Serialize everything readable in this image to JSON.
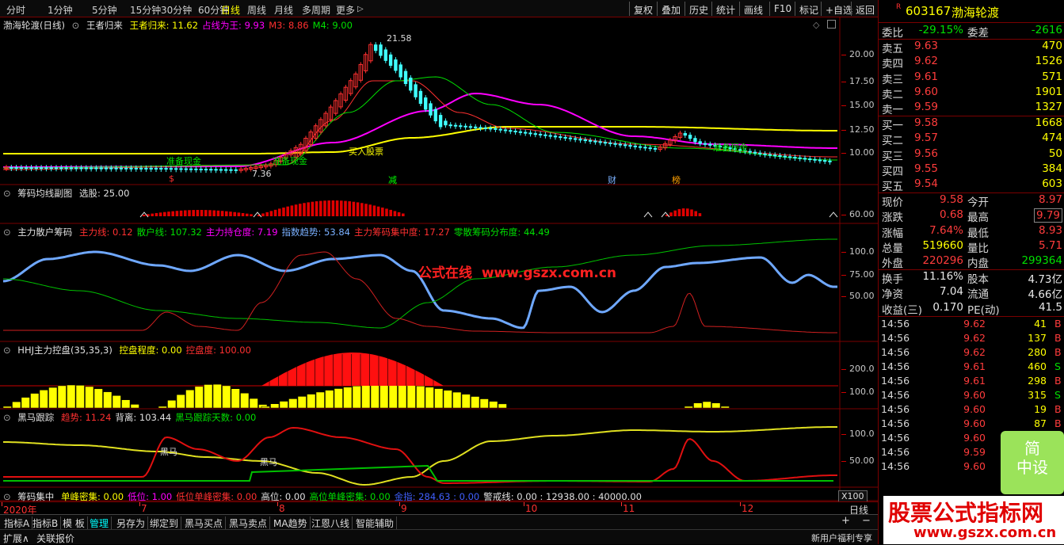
{
  "toolbar": {
    "periods": [
      "分时",
      "1分钟",
      "5分钟",
      "15分钟",
      "30分钟",
      "60分钟",
      "日线",
      "周线",
      "月线",
      "多周期",
      "更多"
    ],
    "active_period": "日线",
    "more_arrow": "▷",
    "right_buttons": [
      "复权",
      "叠加",
      "历史",
      "统计",
      "画线",
      "F10",
      "标记",
      "+自选",
      "返回"
    ]
  },
  "main_panel": {
    "title": "渤海轮渡(日线)",
    "indicator": "王者归来",
    "labels": [
      {
        "text": "王者归来: 11.62",
        "color": "#ffff00"
      },
      {
        "text": "占线为王: 9.93",
        "color": "#ff00ff"
      },
      {
        "text": "M3: 8.86",
        "color": "#ff3030"
      },
      {
        "text": "M4: 9.00",
        "color": "#00e000"
      }
    ],
    "y_ticks": [
      "20.00",
      "17.50",
      "15.00",
      "12.50",
      "10.00"
    ],
    "annotations": {
      "high_price": "21.58",
      "low_price": "7.36",
      "signal_1": "准备现金",
      "signal_2": "准备现金",
      "signal_3": "买入股票",
      "signal_4": "准备现金",
      "marker_s": "$",
      "marker_jian": "减",
      "marker_cai": "财",
      "marker_bang": "榜"
    }
  },
  "panel2": {
    "title": "筹码均线副图",
    "labels": [
      {
        "text": "选股: 25.00",
        "color": "#e0e0e0"
      }
    ],
    "y_ticks": [
      "60.00"
    ]
  },
  "panel3": {
    "title": "主力散户筹码",
    "labels": [
      {
        "text": "主力线: 0.12",
        "color": "#ff3030"
      },
      {
        "text": "散户线: 107.32",
        "color": "#00e000"
      },
      {
        "text": "主力持仓度: 7.19",
        "color": "#ff00ff"
      },
      {
        "text": "指数趋势: 53.84",
        "color": "#7ab0ff"
      },
      {
        "text": "主力筹码集中度: 17.27",
        "color": "#ff3030"
      },
      {
        "text": "零散筹码分布度: 44.49",
        "color": "#00e000"
      }
    ],
    "y_ticks": [
      "100.0",
      "75.00",
      "50.00"
    ],
    "watermark": "公式在线  www.gszx.com.cn"
  },
  "panel4": {
    "title": "HHJ主力控盘(35,35,3)",
    "labels": [
      {
        "text": "控盘程度: 0.00",
        "color": "#ffff00"
      },
      {
        "text": "控盘度: 100.00",
        "color": "#ff3030"
      }
    ],
    "y_ticks": [
      "200.0",
      "100.0"
    ]
  },
  "panel5": {
    "title": "黑马跟踪",
    "labels": [
      {
        "text": "趋势: 11.24",
        "color": "#ff3030"
      },
      {
        "text": "背离: 103.44",
        "color": "#e0e0e0"
      },
      {
        "text": "黑马跟踪天数: 0.00",
        "color": "#00e000"
      }
    ],
    "y_ticks": [
      "100.0",
      "50.00"
    ],
    "annotations": [
      "黑马",
      "黑马"
    ]
  },
  "panel6": {
    "title": "筹码集中",
    "labels": [
      {
        "text": "单峰密集: 0.00",
        "color": "#ffff00"
      },
      {
        "text": "低位: 1.00",
        "color": "#ff00ff"
      },
      {
        "text": "低位单峰密集: 0.00",
        "color": "#ff3030"
      },
      {
        "text": "高位: 0.00",
        "color": "#e0e0e0"
      },
      {
        "text": "高位单峰密集: 0.00",
        "color": "#00e000"
      },
      {
        "text": "金指: 284.63 : 0.00",
        "color": "#4060ff"
      },
      {
        "text": "警戒线: 0.00 : 12938.00 : 40000.00",
        "color": "#e0e0e0"
      }
    ],
    "zoom": "X100"
  },
  "date_axis": {
    "labels": [
      "2020年",
      "7",
      "8",
      "9",
      "10",
      "11",
      "12"
    ],
    "period_label": "日线"
  },
  "bottom_tabs": [
    "指标A",
    "指标B",
    "模 板",
    "管理",
    "另存为",
    "绑定到",
    "黑马买点",
    "黑马卖点",
    "MA趋势",
    "江恩八线",
    "智能辅助"
  ],
  "active_tab": "管理",
  "status": {
    "left1": "扩展∧",
    "left2": "关联报价",
    "right": "新用户福利专享"
  },
  "quote": {
    "r_mark": "R",
    "code": "603167",
    "name": "渤海轮渡",
    "wb_label": "委比",
    "wb_value": "-29.15%",
    "wc_label": "委差",
    "wc_value": "-2616",
    "asks": [
      {
        "label": "卖五",
        "price": "9.63",
        "vol": "470"
      },
      {
        "label": "卖四",
        "price": "9.62",
        "vol": "1526"
      },
      {
        "label": "卖三",
        "price": "9.61",
        "vol": "571"
      },
      {
        "label": "卖二",
        "price": "9.60",
        "vol": "1901"
      },
      {
        "label": "卖一",
        "price": "9.59",
        "vol": "1327"
      }
    ],
    "bids": [
      {
        "label": "买一",
        "price": "9.58",
        "vol": "1668"
      },
      {
        "label": "买二",
        "price": "9.57",
        "vol": "474"
      },
      {
        "label": "买三",
        "price": "9.56",
        "vol": "50"
      },
      {
        "label": "买四",
        "price": "9.55",
        "vol": "384"
      },
      {
        "label": "买五",
        "price": "9.54",
        "vol": "603"
      }
    ],
    "stats1": [
      {
        "l": "现价",
        "v": "9.58",
        "vc": "red",
        "l2": "今开",
        "v2": "8.97",
        "v2c": "red"
      },
      {
        "l": "涨跌",
        "v": "0.68",
        "vc": "red",
        "l2": "最高",
        "v2": "9.79",
        "v2c": "red"
      },
      {
        "l": "涨幅",
        "v": "7.64%",
        "vc": "red",
        "l2": "最低",
        "v2": "8.93",
        "v2c": "red"
      },
      {
        "l": "总量",
        "v": "519660",
        "vc": "yellow",
        "l2": "量比",
        "v2": "5.71",
        "v2c": "red"
      },
      {
        "l": "外盘",
        "v": "220296",
        "vc": "red",
        "l2": "内盘",
        "v2": "299364",
        "v2c": "green"
      }
    ],
    "stats2": [
      {
        "l": "换手",
        "v": "11.16%",
        "l2": "股本",
        "v2": "4.73亿"
      },
      {
        "l": "净资",
        "v": "7.04",
        "l2": "流通",
        "v2": "4.66亿"
      },
      {
        "l": "收益(三)",
        "v": "0.170",
        "l2": "PE(动)",
        "v2": "41.5"
      }
    ],
    "ticks": [
      {
        "t": "14:56",
        "p": "9.62",
        "v": "41",
        "s": "B"
      },
      {
        "t": "14:56",
        "p": "9.62",
        "v": "137",
        "s": "B"
      },
      {
        "t": "14:56",
        "p": "9.62",
        "v": "280",
        "s": "B"
      },
      {
        "t": "14:56",
        "p": "9.61",
        "v": "460",
        "s": "S"
      },
      {
        "t": "14:56",
        "p": "9.61",
        "v": "298",
        "s": "B"
      },
      {
        "t": "14:56",
        "p": "9.60",
        "v": "315",
        "s": "S"
      },
      {
        "t": "14:56",
        "p": "9.60",
        "v": "19",
        "s": "B"
      },
      {
        "t": "14:56",
        "p": "9.60",
        "v": "87",
        "s": "B"
      },
      {
        "t": "14:56",
        "p": "9.60",
        "v": "",
        "s": ""
      },
      {
        "t": "14:56",
        "p": "9.59",
        "v": "",
        "s": ""
      },
      {
        "t": "14:56",
        "p": "9.60",
        "v": "",
        "s": ""
      }
    ],
    "promo_text": "简\n中设"
  },
  "site_watermark": {
    "line1": "股票公式指标网",
    "line2": "www.gszx.com.cn"
  }
}
